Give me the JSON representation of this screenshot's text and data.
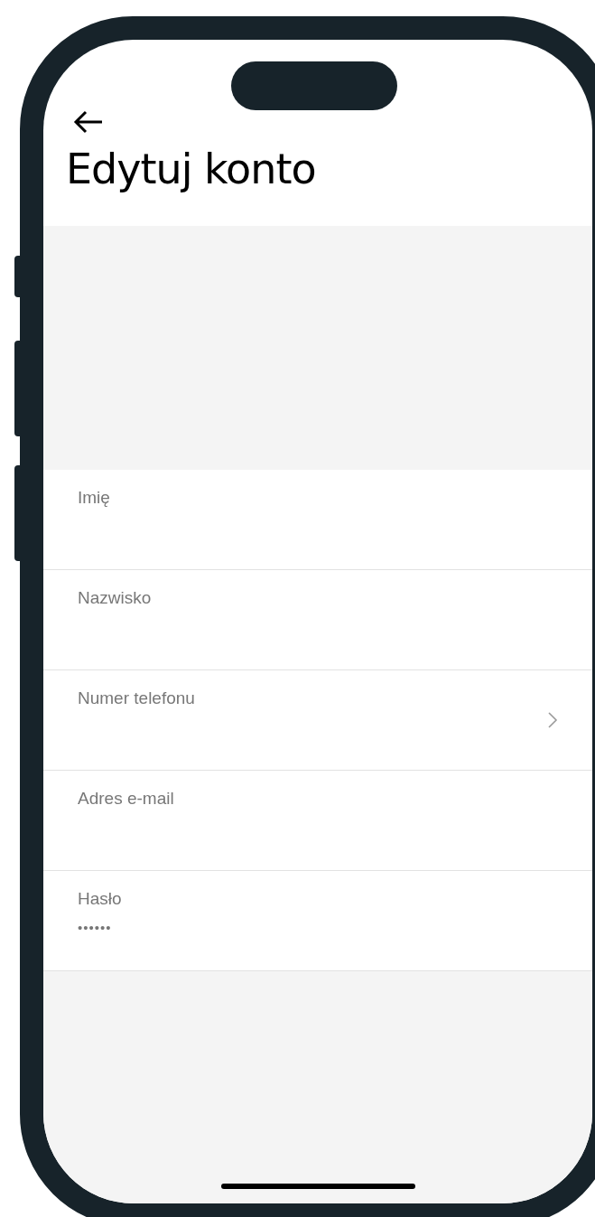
{
  "header": {
    "title": "Edytuj konto"
  },
  "fields": [
    {
      "label": "Imię",
      "chevron": false
    },
    {
      "label": "Nazwisko",
      "chevron": false
    },
    {
      "label": "Numer telefonu",
      "chevron": true
    },
    {
      "label": "Adres e-mail",
      "chevron": false
    },
    {
      "label": "Hasło",
      "value": "••••••",
      "chevron": false
    }
  ]
}
